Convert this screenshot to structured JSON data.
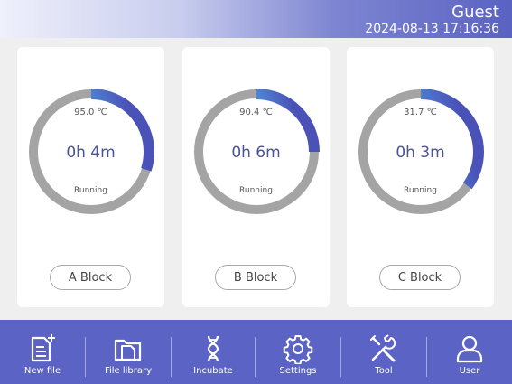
{
  "header": {
    "user": "Guest",
    "datetime": "2024-08-13 17:16:36"
  },
  "blocks": [
    {
      "temperature": "95.0 ℃",
      "time": "0h 4m",
      "status": "Running",
      "button": "A Block",
      "progress": 0.3
    },
    {
      "temperature": "90.4 ℃",
      "time": "0h 6m",
      "status": "Running",
      "button": "B Block",
      "progress": 0.25
    },
    {
      "temperature": "31.7 ℃",
      "time": "0h 3m",
      "status": "Running",
      "button": "C Block",
      "progress": 0.35
    }
  ],
  "toolbar": {
    "items": [
      {
        "label": "New file",
        "icon": "new-file-icon"
      },
      {
        "label": "File library",
        "icon": "folder-icon"
      },
      {
        "label": "Incubate",
        "icon": "dna-icon"
      },
      {
        "label": "Settings",
        "icon": "gear-icon"
      },
      {
        "label": "Tool",
        "icon": "tools-icon"
      },
      {
        "label": "User",
        "icon": "user-icon"
      }
    ]
  },
  "colors": {
    "toolbar": "#5b64c4",
    "ring_track": "#a4a4a4",
    "ring_start": "#7fd3e6",
    "ring_end": "#4a52b8",
    "time_text": "#4a5298"
  }
}
